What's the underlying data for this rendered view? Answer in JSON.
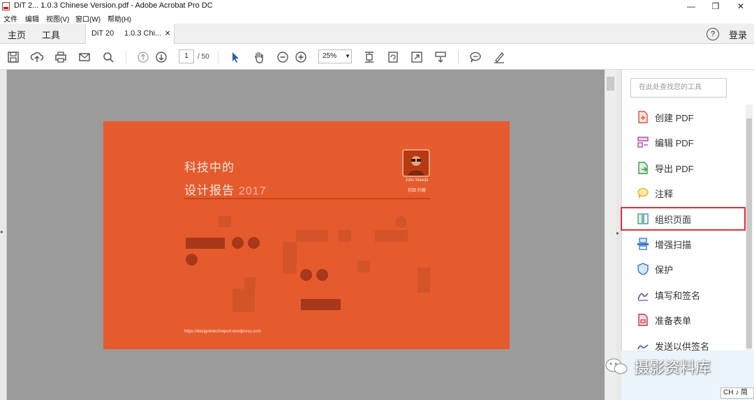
{
  "window": {
    "title": "DiT 2...  1.0.3 Chinese Version.pdf - Adobe Acrobat Pro DC",
    "minimize": "—",
    "maximize": "❐",
    "close": "✕"
  },
  "menu": {
    "items": [
      "文件",
      "编辑",
      "视图(V)",
      "窗口(W)",
      "帮助(H)"
    ]
  },
  "tabs": {
    "home": "主页",
    "tools": "工具",
    "doc1": "DiT 20",
    "doc2": "1.0.3 Chi...",
    "close": "×",
    "help": "?",
    "login": "登录"
  },
  "toolbar": {
    "page_current": "1",
    "page_total": "/ 50",
    "zoom": "25%",
    "icons": [
      "save-icon",
      "upload-icon",
      "print-icon",
      "mail-icon",
      "search-icon",
      "page-up-icon",
      "page-down-icon",
      "select-cursor-icon",
      "hand-icon",
      "zoom-out-icon",
      "zoom-in-icon",
      "fit-page-icon",
      "rotate-icon",
      "fullscreen-icon",
      "scroll-mode-icon",
      "comment-icon",
      "sign-icon"
    ]
  },
  "document": {
    "heading1": "科技中的",
    "heading2": "设计报告",
    "year": "2017",
    "qr_name": "John Maeda",
    "qr_name_cn": "前田 约翰",
    "url": "https://designintechreport.wordpress.com"
  },
  "tools_panel": {
    "search_placeholder": "在此处查找您的工具",
    "items": [
      {
        "label": "创建 PDF",
        "icon": "create-pdf-icon",
        "color": "#e0523a"
      },
      {
        "label": "编辑 PDF",
        "icon": "edit-pdf-icon",
        "color": "#a83c9b"
      },
      {
        "label": "导出 PDF",
        "icon": "export-pdf-icon",
        "color": "#3a9a4a"
      },
      {
        "label": "注释",
        "icon": "comment-icon",
        "color": "#f0c020"
      },
      {
        "label": "组织页面",
        "icon": "organize-pages-icon",
        "color": "#3aa05a"
      },
      {
        "label": "增强扫描",
        "icon": "scan-icon",
        "color": "#3a78c8"
      },
      {
        "label": "保护",
        "icon": "protect-icon",
        "color": "#3a78c8"
      },
      {
        "label": "填写和签名",
        "icon": "fill-sign-icon",
        "color": "#6a4aa8"
      },
      {
        "label": "准备表单",
        "icon": "prepare-form-icon",
        "color": "#c8344a"
      },
      {
        "label": "发送以供签名",
        "icon": "send-sign-icon",
        "color": "#3a58b8"
      }
    ]
  },
  "watermark": {
    "text": "摄影资料库"
  },
  "ime": {
    "text": "CH ♪ 简"
  }
}
